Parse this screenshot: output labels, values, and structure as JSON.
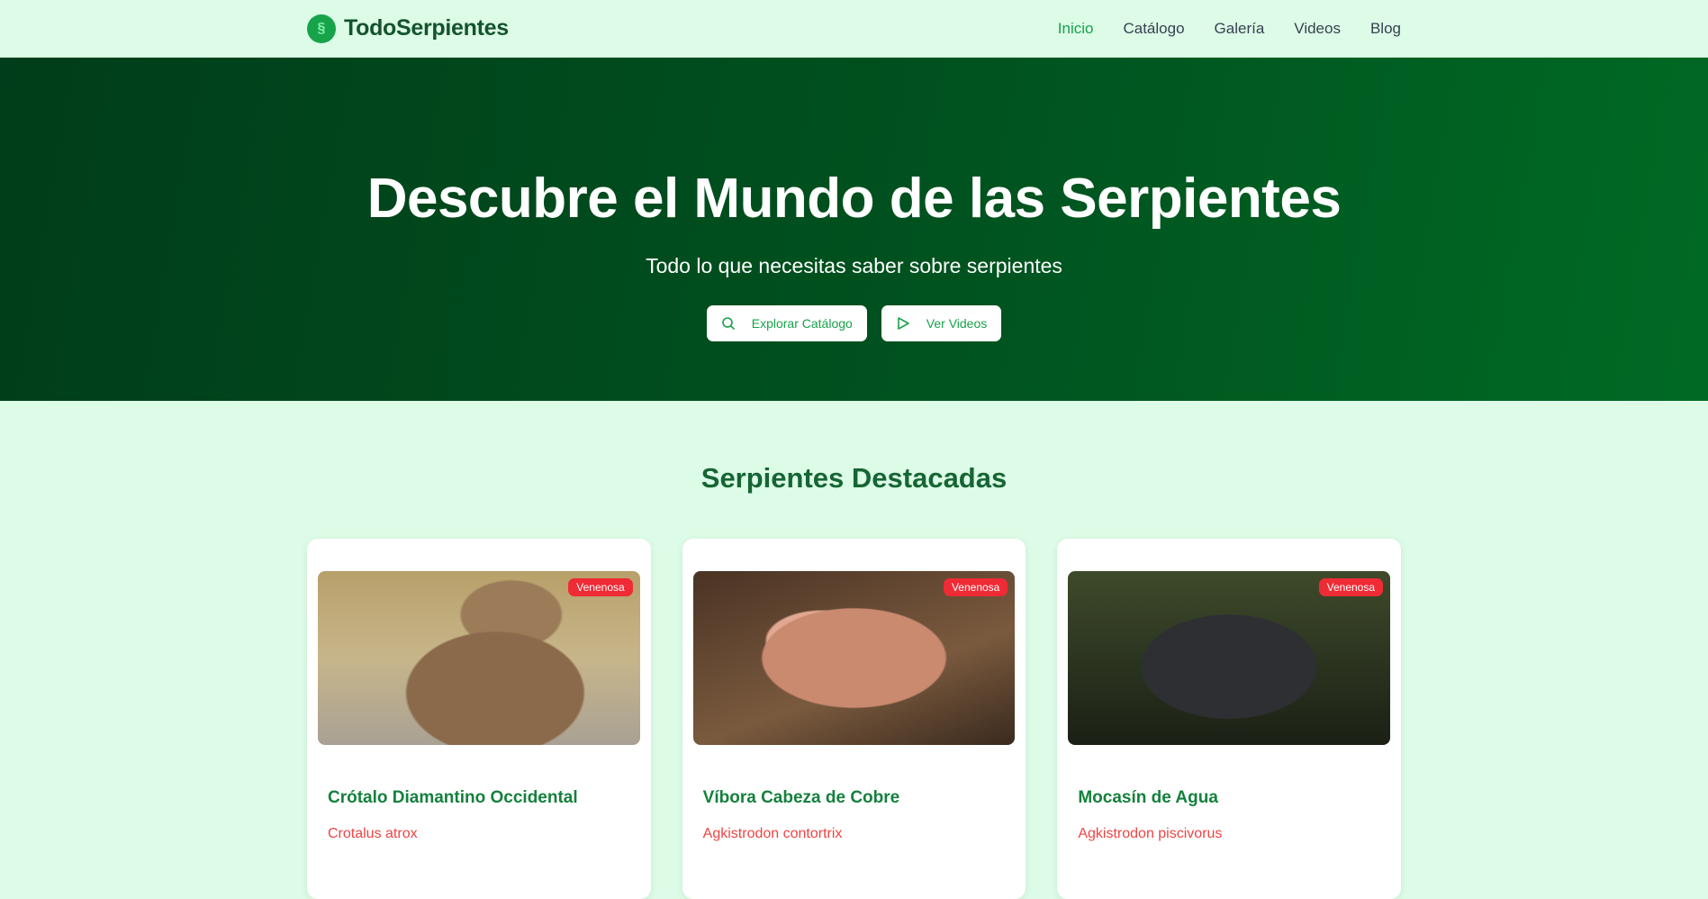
{
  "header": {
    "logo_text": "TodoSerpientes",
    "nav": [
      "Inicio",
      "Catálogo",
      "Galería",
      "Videos",
      "Blog"
    ]
  },
  "hero": {
    "title": "Descubre el Mundo de las Serpientes",
    "subtitle": "Todo lo que necesitas saber sobre serpientes",
    "buttons": [
      {
        "label": "Explorar Catálogo",
        "icon": "search-icon"
      },
      {
        "label": "Ver Videos",
        "icon": "play-icon"
      }
    ]
  },
  "featured": {
    "title": "Serpientes Destacadas",
    "cards": [
      {
        "name": "Crótalo Diamantino Occidental",
        "scientific": "Crotalus atrox",
        "badge": "Venenosa"
      },
      {
        "name": "Víbora Cabeza de Cobre",
        "scientific": "Agkistrodon contortrix",
        "badge": "Venenosa"
      },
      {
        "name": "Mocasín de Agua",
        "scientific": "Agkistrodon piscivorus",
        "badge": "Venenosa"
      }
    ]
  },
  "colors": {
    "accent": "#16a34a",
    "badge": "#ef2b35",
    "hero": "#00521f"
  }
}
